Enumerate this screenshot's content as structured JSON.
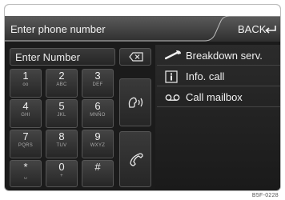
{
  "header": {
    "title": "Enter phone number",
    "back_label": "BACK"
  },
  "input": {
    "placeholder": "Enter Number"
  },
  "keypad": [
    {
      "digit": "1",
      "sub": "oo"
    },
    {
      "digit": "2",
      "sub": "ABC"
    },
    {
      "digit": "3",
      "sub": "DEF"
    },
    {
      "digit": "4",
      "sub": "GHI"
    },
    {
      "digit": "5",
      "sub": "JKL"
    },
    {
      "digit": "6",
      "sub": "MNÑO"
    },
    {
      "digit": "7",
      "sub": "PQRS"
    },
    {
      "digit": "8",
      "sub": "TUV"
    },
    {
      "digit": "9",
      "sub": "WXYZ"
    },
    {
      "digit": "*",
      "sub": "␣"
    },
    {
      "digit": "0",
      "sub": "+"
    },
    {
      "digit": "#",
      "sub": ""
    }
  ],
  "menu": {
    "breakdown": "Breakdown serv.",
    "info": "Info. call",
    "mailbox": "Call mailbox"
  },
  "code": "B5F-0228",
  "colors": {
    "background": "#1b1b1b",
    "text": "#f0f0f0"
  }
}
